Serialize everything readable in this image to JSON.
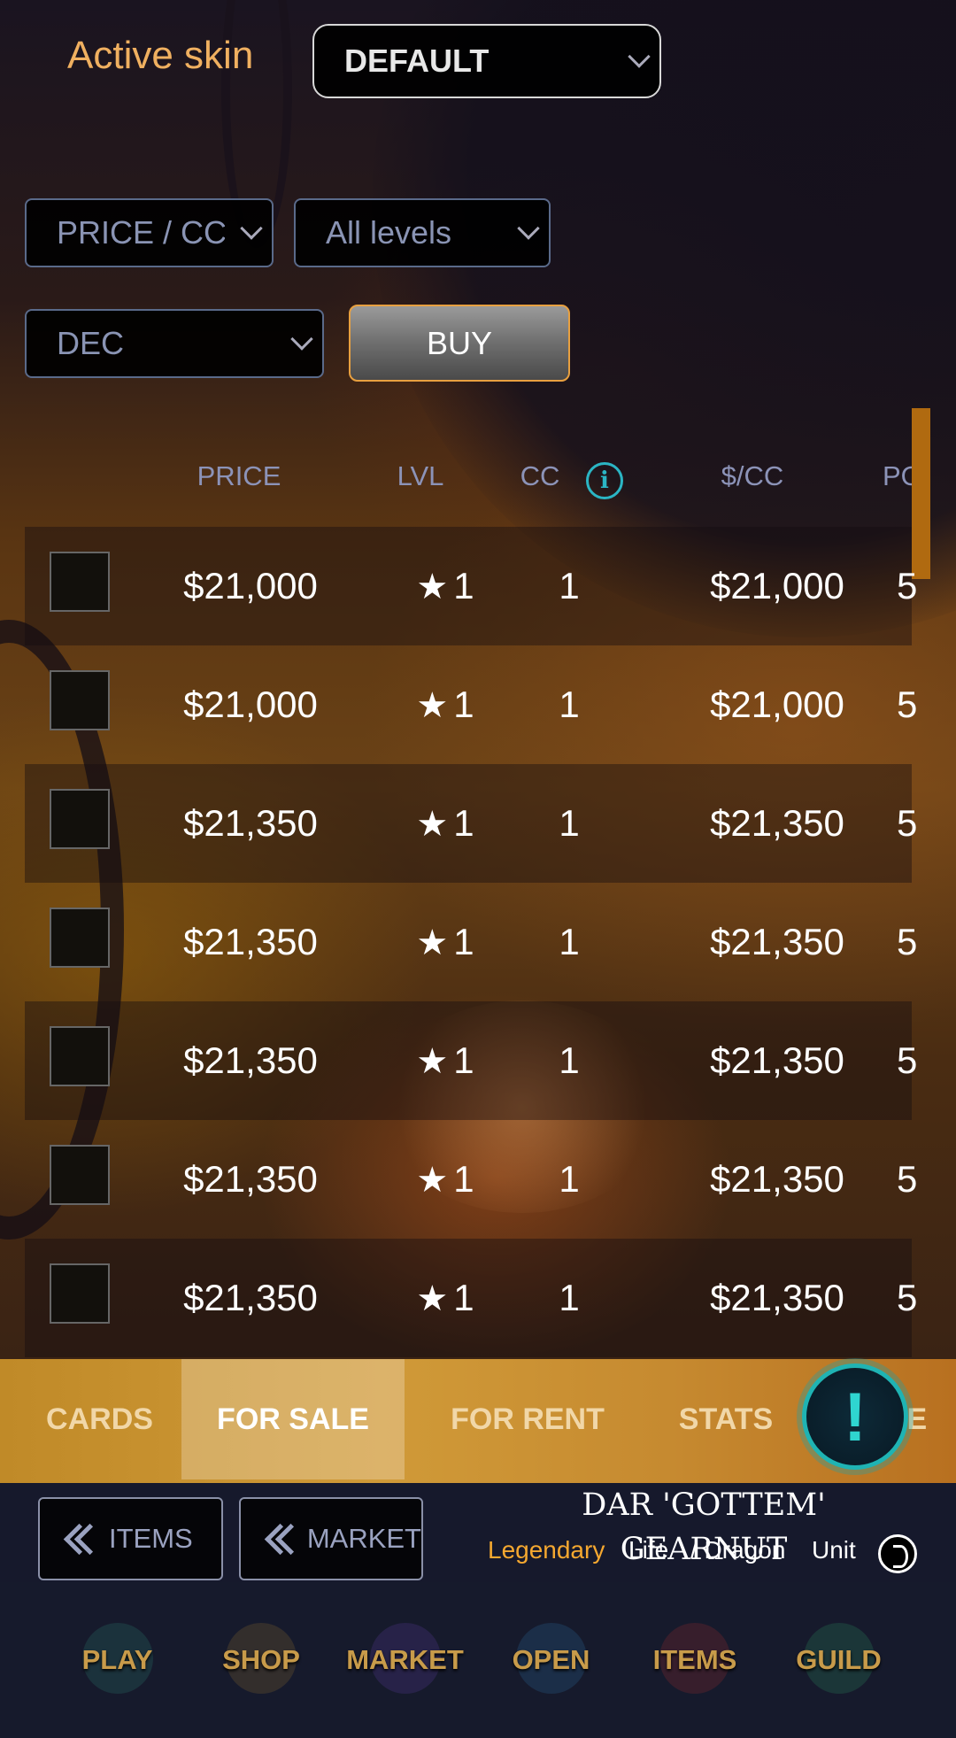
{
  "top": {
    "skin_label": "Active skin",
    "skin_value": "DEFAULT"
  },
  "filters": {
    "sort_value": "PRICE / CC",
    "level_value": "All levels",
    "order_value": "DEC",
    "buy_label": "BUY"
  },
  "table": {
    "headers": [
      "PRICE",
      "LVL",
      "CC",
      "$/CC",
      "PO"
    ],
    "rows": [
      {
        "price": "$21,000",
        "lvl": "1",
        "cc": "1",
        "per_cc": "$21,000",
        "po": "5"
      },
      {
        "price": "$21,000",
        "lvl": "1",
        "cc": "1",
        "per_cc": "$21,000",
        "po": "5"
      },
      {
        "price": "$21,350",
        "lvl": "1",
        "cc": "1",
        "per_cc": "$21,350",
        "po": "5"
      },
      {
        "price": "$21,350",
        "lvl": "1",
        "cc": "1",
        "per_cc": "$21,350",
        "po": "5"
      },
      {
        "price": "$21,350",
        "lvl": "1",
        "cc": "1",
        "per_cc": "$21,350",
        "po": "5"
      },
      {
        "price": "$21,350",
        "lvl": "1",
        "cc": "1",
        "per_cc": "$21,350",
        "po": "5"
      },
      {
        "price": "$21,350",
        "lvl": "1",
        "cc": "1",
        "per_cc": "$21,350",
        "po": "5"
      }
    ]
  },
  "tabs": {
    "cards": "CARDS",
    "for_sale": "FOR SALE",
    "for_rent": "FOR RENT",
    "stats": "STATS",
    "more": "RE",
    "alert": "!"
  },
  "nav": {
    "back_items": "ITEMS",
    "back_market": "MARKET"
  },
  "card": {
    "name": "DAR 'GOTTEM' GEARNUT",
    "rarity": "Legendary",
    "element": "Life",
    "type": "/ Dragon",
    "kind": "Unit"
  },
  "bottom_nav": {
    "play": "PLAY",
    "shop": "SHOP",
    "market": "MARKET",
    "open": "OPEN",
    "items": "ITEMS",
    "guild": "GUILD"
  },
  "colors": {
    "accent_gold": "#f0b060",
    "info_teal": "#2bb5c4",
    "legendary": "#f5a830",
    "tab_bar": "#c08a28",
    "nav_bg": "#16192c"
  },
  "icons": [
    "chevron-down-icon",
    "info-icon",
    "star-icon",
    "double-chevron-left-icon",
    "alert-icon",
    "card-detail-icon"
  ]
}
